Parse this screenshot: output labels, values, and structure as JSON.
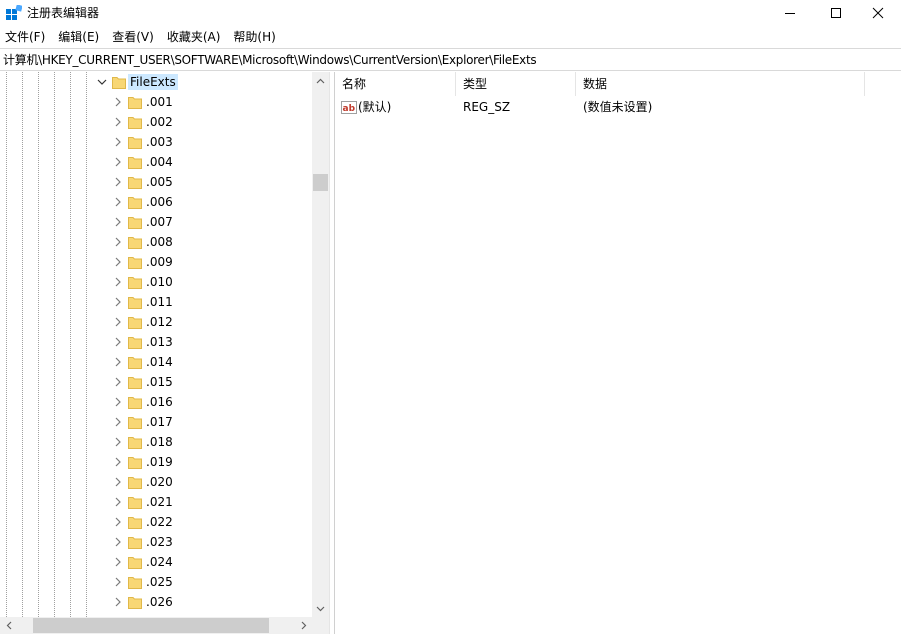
{
  "window": {
    "title": "注册表编辑器",
    "accent": "#0078d7"
  },
  "menu": {
    "items": [
      {
        "label": "文件(F)"
      },
      {
        "label": "编辑(E)"
      },
      {
        "label": "查看(V)"
      },
      {
        "label": "收藏夹(A)"
      },
      {
        "label": "帮助(H)"
      }
    ]
  },
  "address": {
    "path": "计算机\\HKEY_CURRENT_USER\\SOFTWARE\\Microsoft\\Windows\\CurrentVersion\\Explorer\\FileExts"
  },
  "tree": {
    "selected": {
      "label": "FileExts",
      "expanded": true,
      "highlight": "#cce8ff"
    },
    "children": [
      {
        "label": ".001"
      },
      {
        "label": ".002"
      },
      {
        "label": ".003"
      },
      {
        "label": ".004"
      },
      {
        "label": ".005"
      },
      {
        "label": ".006"
      },
      {
        "label": ".007"
      },
      {
        "label": ".008"
      },
      {
        "label": ".009"
      },
      {
        "label": ".010"
      },
      {
        "label": ".011"
      },
      {
        "label": ".012"
      },
      {
        "label": ".013"
      },
      {
        "label": ".014"
      },
      {
        "label": ".015"
      },
      {
        "label": ".016"
      },
      {
        "label": ".017"
      },
      {
        "label": ".018"
      },
      {
        "label": ".019"
      },
      {
        "label": ".020"
      },
      {
        "label": ".021"
      },
      {
        "label": ".022"
      },
      {
        "label": ".023"
      },
      {
        "label": ".024"
      },
      {
        "label": ".025"
      },
      {
        "label": ".026"
      }
    ],
    "folder_color": "#f8d775"
  },
  "list": {
    "columns": [
      {
        "label": "名称"
      },
      {
        "label": "类型"
      },
      {
        "label": "数据"
      }
    ],
    "rows": [
      {
        "name": "(默认)",
        "type": "REG_SZ",
        "data": "(数值未设置)",
        "icon": "string-value-icon"
      }
    ]
  }
}
